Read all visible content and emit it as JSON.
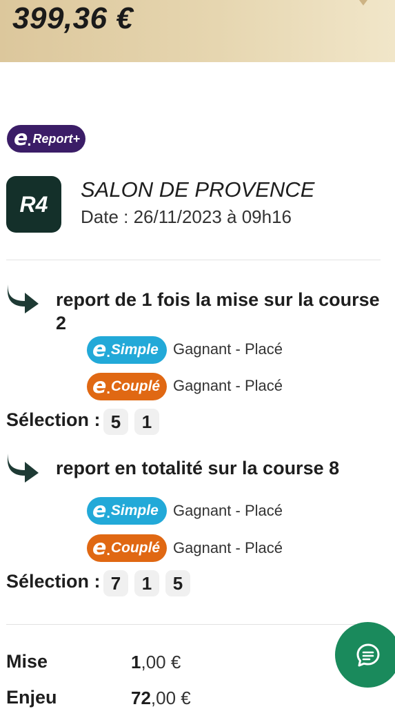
{
  "banner": {
    "amount": "399,36 €"
  },
  "brand": {
    "e_letter": "e",
    "dot": ".",
    "name": "Report+"
  },
  "race": {
    "code": "R4",
    "name": "SALON DE PROVENCE",
    "date": "Date : 26/11/2023 à 09h16"
  },
  "reports": [
    {
      "title": "report de 1 fois la mise sur la course 2",
      "bets": [
        {
          "type": "Simple",
          "desc": "Gagnant - Placé",
          "color": "#22a9d8"
        },
        {
          "type": "Couplé",
          "desc": "Gagnant - Placé",
          "color": "#e06813"
        }
      ],
      "selection_label": "Sélection :",
      "selection": [
        "5",
        "1"
      ]
    },
    {
      "title": "report en totalité sur la course 8",
      "bets": [
        {
          "type": "Simple",
          "desc": "Gagnant - Placé",
          "color": "#22a9d8"
        },
        {
          "type": "Couplé",
          "desc": "Gagnant - Placé",
          "color": "#e06813"
        }
      ],
      "selection_label": "Sélection :",
      "selection": [
        "7",
        "1",
        "5"
      ]
    }
  ],
  "summary": {
    "mise_label": "Mise",
    "mise_int": "1",
    "mise_rest": ",00 €",
    "enjeu_label": "Enjeu",
    "enjeu_int": "72",
    "enjeu_rest": ",00 €"
  },
  "colors": {
    "brand_purple": "#3b1d67",
    "race_box": "#14302a",
    "fab": "#1a8a5c"
  },
  "icons": {
    "report_arrow": "return-arrow-icon",
    "chat": "chat-icon"
  }
}
